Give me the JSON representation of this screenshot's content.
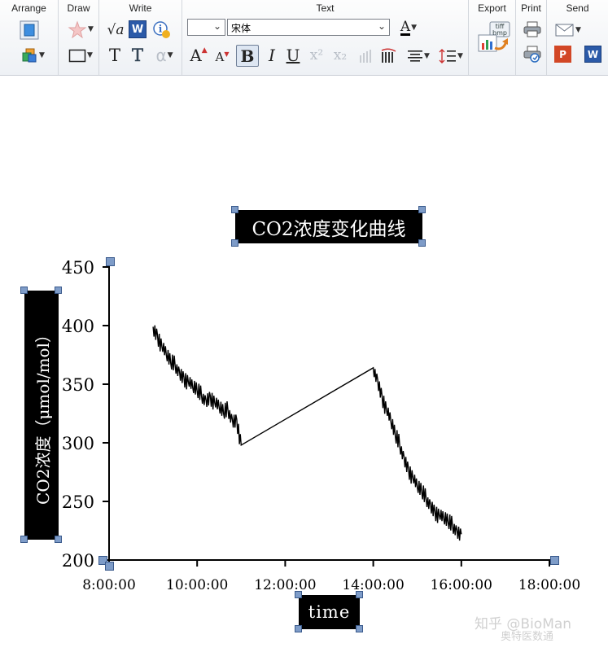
{
  "toolbar": {
    "groups": {
      "arrange": "Arrange",
      "draw": "Draw",
      "write": "Write",
      "text": "Text",
      "export": "Export",
      "print": "Print",
      "send": "Send"
    },
    "font_size_value": "",
    "font_name_value": "宋体",
    "glyphs": {
      "sqrt": "√a",
      "plain_t": "T",
      "outline_t": "T",
      "alpha": "α",
      "grow": "A",
      "shrink": "A",
      "bold": "B",
      "italic": "I",
      "underline": "U",
      "superscript": "x²",
      "subscript": "x₂",
      "font_color": "A",
      "word": "W",
      "powerpoint": "P",
      "send_word": "W",
      "export_tiff": "tiff",
      "export_bmp": "bmp"
    }
  },
  "chart_data": {
    "type": "line",
    "title": "CO2浓度变化曲线",
    "xlabel": "time",
    "ylabel": "CO2浓度（μmol/mol）",
    "x_ticks": [
      "8:00:00",
      "10:00:00",
      "12:00:00",
      "14:00:00",
      "16:00:00",
      "18:00:00"
    ],
    "y_ticks": [
      "200",
      "250",
      "300",
      "350",
      "400",
      "450"
    ],
    "xlim_hours": [
      8,
      18
    ],
    "ylim": [
      200,
      450
    ],
    "series": [
      {
        "x_hours": [
          9.0,
          9.1,
          9.2,
          9.3,
          9.4,
          9.5,
          9.6,
          9.7,
          9.8,
          9.9,
          10.0,
          10.1,
          10.2,
          10.3,
          10.4,
          10.5,
          10.6,
          10.7,
          10.8,
          10.9,
          11.0,
          12.0,
          13.0,
          14.0,
          14.1,
          14.2,
          14.3,
          14.4,
          14.5,
          14.6,
          14.7,
          14.8,
          14.9,
          15.0,
          15.1,
          15.2,
          15.3,
          15.4,
          15.5,
          15.6,
          15.7,
          15.8,
          15.9,
          16.0
        ],
        "y": [
          399,
          392,
          382,
          375,
          368,
          366,
          361,
          356,
          352,
          347,
          344,
          340,
          337,
          340,
          334,
          330,
          325,
          328,
          320,
          320,
          298,
          320,
          342,
          364,
          354,
          340,
          328,
          318,
          306,
          298,
          288,
          278,
          270,
          262,
          258,
          252,
          248,
          242,
          238,
          235,
          232,
          229,
          226,
          222
        ]
      }
    ]
  },
  "watermark": {
    "line1": "知乎 @BioMan",
    "line2": "奥特医数通"
  }
}
